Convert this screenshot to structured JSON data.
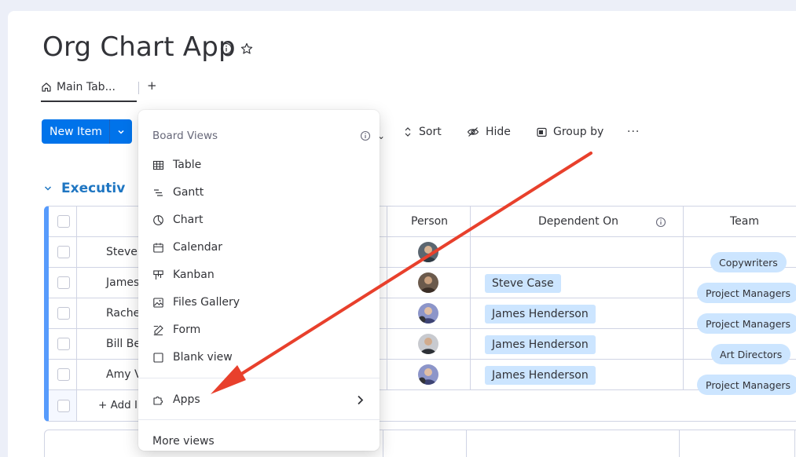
{
  "board": {
    "title": "Org Chart App",
    "tabs": [
      {
        "label": "Main Tab..."
      }
    ],
    "add_tab_label": "+"
  },
  "toolbar": {
    "new_item_label": "New Item",
    "sort_label": "Sort",
    "hide_label": "Hide",
    "group_by_label": "Group by",
    "more_label": "···"
  },
  "group": {
    "name": "Executiv",
    "color": "#579bfc",
    "columns": [
      "Person",
      "Dependent On",
      "Team"
    ],
    "rows": [
      {
        "name": "Steve",
        "dependent_on": "",
        "team": "Copywriters"
      },
      {
        "name": "James",
        "dependent_on": "Steve Case",
        "team": "Project Managers"
      },
      {
        "name": "Rache",
        "dependent_on": "James Henderson",
        "team": "Project Managers"
      },
      {
        "name": "Bill Be",
        "dependent_on": "James Henderson",
        "team": "Art Directors"
      },
      {
        "name": "Amy V",
        "dependent_on": "James Henderson",
        "team": "Project Managers"
      }
    ],
    "add_item_label": "+ Add I"
  },
  "views_menu": {
    "header": "Board Views",
    "items": [
      {
        "label": "Table",
        "icon": "table-icon"
      },
      {
        "label": "Gantt",
        "icon": "gantt-icon"
      },
      {
        "label": "Chart",
        "icon": "chart-icon"
      },
      {
        "label": "Calendar",
        "icon": "calendar-icon"
      },
      {
        "label": "Kanban",
        "icon": "kanban-icon"
      },
      {
        "label": "Files Gallery",
        "icon": "files-gallery-icon"
      },
      {
        "label": "Form",
        "icon": "form-icon"
      },
      {
        "label": "Blank view",
        "icon": "blank-view-icon"
      }
    ],
    "apps_label": "Apps",
    "more_views_label": "More views"
  },
  "colors": {
    "primary": "#0073ea",
    "group_blue": "#1f76c2",
    "pill_bg": "#cce5ff",
    "annotation_arrow": "#e8402c"
  }
}
